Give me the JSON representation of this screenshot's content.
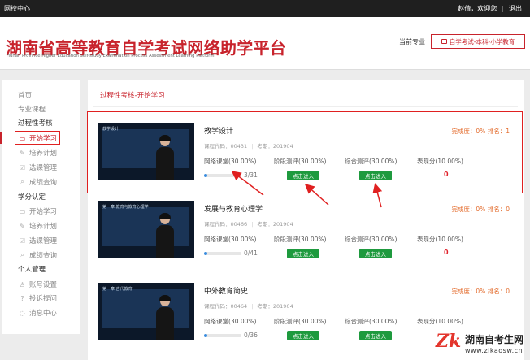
{
  "topbar": {
    "site_label": "网校中心",
    "greeting": "赵倩，欢迎您",
    "logout": "退出"
  },
  "header": {
    "title_cn": "湖南省高等教育自学考试网络助学平台",
    "title_en": "Hunan Province Higher Education Self-study Examination Process Assessment Learning Platform",
    "major_label": "当前专业",
    "major_button": "自学考试-本科-小学教育"
  },
  "sidebar": {
    "items": [
      {
        "label": "首页",
        "type": "link",
        "icon": ""
      },
      {
        "label": "专业课程",
        "type": "link",
        "icon": ""
      },
      {
        "label": "过程性考核",
        "type": "head",
        "icon": ""
      },
      {
        "label": "开始学习",
        "type": "sub",
        "icon": "monitor-icon",
        "active": true
      },
      {
        "label": "培养计划",
        "type": "sub",
        "icon": "pin-icon"
      },
      {
        "label": "选课管理",
        "type": "sub",
        "icon": "checkbox-icon"
      },
      {
        "label": "成绩查询",
        "type": "sub",
        "icon": "search-icon"
      },
      {
        "label": "学分认定",
        "type": "head",
        "icon": ""
      },
      {
        "label": "开始学习",
        "type": "sub",
        "icon": "monitor-icon"
      },
      {
        "label": "培养计划",
        "type": "sub",
        "icon": "pin-icon"
      },
      {
        "label": "选课管理",
        "type": "sub",
        "icon": "checkbox-icon"
      },
      {
        "label": "成绩查询",
        "type": "sub",
        "icon": "search-icon"
      },
      {
        "label": "个人管理",
        "type": "head",
        "icon": ""
      },
      {
        "label": "账号设置",
        "type": "sub",
        "icon": "user-icon"
      },
      {
        "label": "投诉提问",
        "type": "sub",
        "icon": "help-icon"
      },
      {
        "label": "消息中心",
        "type": "sub",
        "icon": "message-icon"
      }
    ]
  },
  "breadcrumb": "过程性考核-开始学习",
  "columns": {
    "online": "网络课堂(30.00%)",
    "stage": "阶段测评(30.00%)",
    "comprehensive": "综合测评(30.00%)",
    "performance": "表现分(10.00%)"
  },
  "enter_label": "点击进入",
  "courses": [
    {
      "name": "教学设计",
      "code": "课程代码：00431",
      "term": "考期：201904",
      "status": "完成度：0%  排名：1",
      "progress_text": "3/31",
      "progress": 0.097,
      "score": "0",
      "thumb_title": "教学设计"
    },
    {
      "name": "发展与教育心理学",
      "code": "课程代码：00466",
      "term": "考期：201904",
      "status": "完成度：0%  排名：0",
      "progress_text": "0/41",
      "progress": 0,
      "score": "0",
      "thumb_title": "第一章 教育与教育心理学"
    },
    {
      "name": "中外教育简史",
      "code": "课程代码：00464",
      "term": "考期：201904",
      "status": "完成度：0%  排名：0",
      "progress_text": "0/36",
      "progress": 0,
      "score": "",
      "thumb_title": "第一章 古代教育"
    }
  ],
  "watermark": {
    "logo": "Zk",
    "name": "湖南自考生网",
    "url": "www.zikaosw.cn"
  },
  "colors": {
    "brand": "#c8232c",
    "button_green": "#1e9a3e",
    "progress_blue": "#3a8de0",
    "status_orange": "#e36a2a"
  }
}
